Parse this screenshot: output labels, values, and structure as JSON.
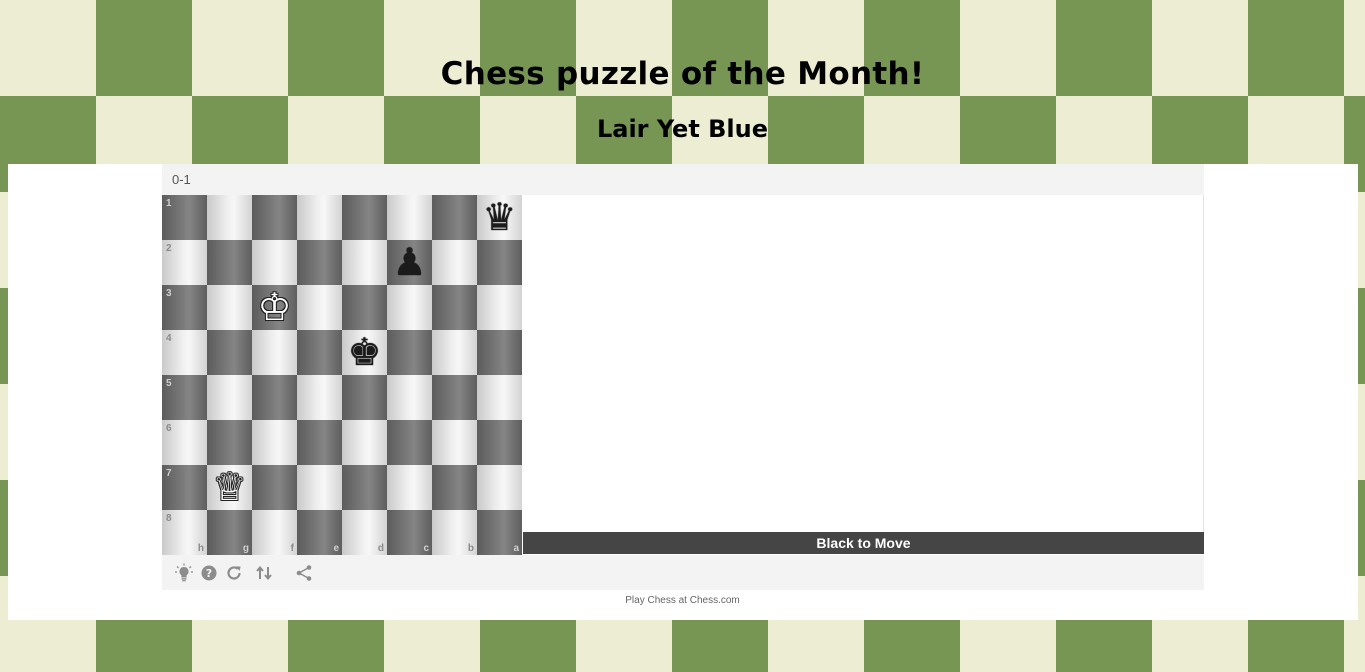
{
  "header": {
    "title": "Chess puzzle of the Month!",
    "subtitle": "Lair Yet Blue"
  },
  "widget": {
    "result": "0-1",
    "to_move": "Black to Move",
    "toolbar": {
      "hint": "hint",
      "help": "help",
      "reset": "reset",
      "flip": "flip board",
      "share": "share"
    }
  },
  "board": {
    "orientation": "black",
    "rank_labels": [
      "1",
      "2",
      "3",
      "4",
      "5",
      "6",
      "7",
      "8"
    ],
    "file_labels": [
      "h",
      "g",
      "f",
      "e",
      "d",
      "c",
      "b",
      "a"
    ],
    "pieces": [
      {
        "square": "a1",
        "piece": "queen",
        "color": "black"
      },
      {
        "square": "c2",
        "piece": "pawn",
        "color": "black"
      },
      {
        "square": "f3",
        "piece": "king",
        "color": "white"
      },
      {
        "square": "d4",
        "piece": "king",
        "color": "black"
      },
      {
        "square": "g7",
        "piece": "queen",
        "color": "white"
      }
    ]
  },
  "footer": {
    "link_text": "Play Chess at Chess.com"
  },
  "colors": {
    "background_light": "#ededd3",
    "background_dark": "#779654",
    "move_bar": "#454545"
  }
}
